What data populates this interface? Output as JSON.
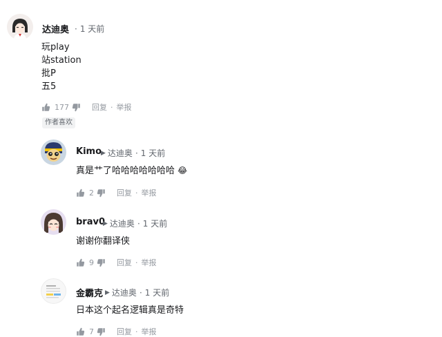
{
  "root_comment": {
    "username": "达迪奥",
    "dot": "·",
    "time": "1 天前",
    "lines": [
      "玩play",
      "站station",
      "批P",
      "五5"
    ],
    "likes": "177",
    "reply_label": "回复",
    "report_label": "举报",
    "badge": "作者喜欢"
  },
  "replies": [
    {
      "username": "Kimo",
      "reply_to": "达迪奥",
      "time": "1 天前",
      "text": "真是艹了哈哈哈哈哈哈哈",
      "emoji": "😂",
      "likes": "2",
      "reply_label": "回复",
      "report_label": "举报"
    },
    {
      "username": "brav0",
      "reply_to": "达迪奥",
      "time": "1 天前",
      "text": "谢谢你翻译侠",
      "likes": "9",
      "reply_label": "回复",
      "report_label": "举报"
    },
    {
      "username": "金霸克",
      "reply_to": "达迪奥",
      "time": "1 天前",
      "text": "日本这个起名逻辑真是奇特",
      "likes": "7",
      "reply_label": "回复",
      "report_label": "举报"
    }
  ],
  "common": {
    "separator": "·",
    "reply_arrow": "▶"
  },
  "icons": {
    "like": "thumb-up-icon",
    "dislike": "thumb-down-icon",
    "reply_arrow": "play-triangle-icon"
  },
  "colors": {
    "text": "#18191c",
    "meta": "#61666d",
    "action": "#9499a0",
    "badge_bg": "#f1f2f3",
    "divider": "#e3e5e7"
  }
}
